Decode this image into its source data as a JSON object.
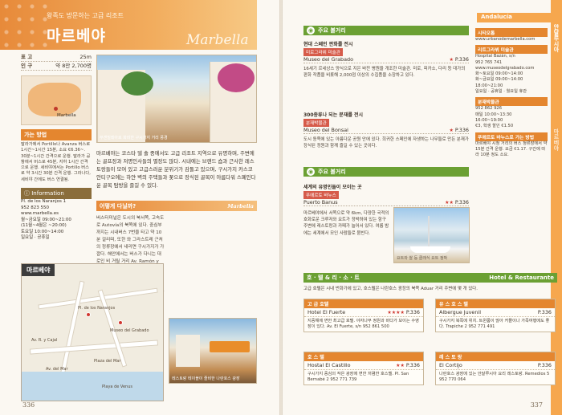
{
  "left": {
    "header": {
      "subtitle": "왕족도 방문하는 고급 리조트",
      "title": "마르베야",
      "title_en": "Marbella"
    },
    "stats": [
      {
        "k": "표 고",
        "v": "25m"
      },
      {
        "k": "인 구",
        "v": "약 8만 2,700명"
      }
    ],
    "map_label": "Marbella",
    "access": {
      "label": "가는 방법",
      "text": "말라가에서 Portillo나 Avanza 버스로 1시간~1시간 15분, 소요 €6.36~. 30분~1시간 간격으로 운행. 말라가 공항에서 버스로 45분, 지하 1시간 간격으로 운행. 세비야에서는 Portillo 버스로 약 3시간 30분 간격 운행. 그라나다, 세비야 간에도 버스 연결됨."
    },
    "info": {
      "label": "Information",
      "lines": [
        "Pl. de los Naranjos 1",
        "952 823 550",
        "www.marbella.es",
        "월~금요일 09:00~21:00",
        "(11월~4월은 ~20:00)",
        "토요일 10:00~14:00",
        "일요일 · 공휴일"
      ]
    },
    "photo_caption": "부겐빌레아로 화려한 구시가지 거리 풍경",
    "intro": "마르베야는 코스타 델 솔 중에서도 고급 리조트 지역으로 유명하며, 주변에는 골프장과 저명인사들의 별장도 많다. 시내에는 브랜드 숍과 근사한 레스토랑들이 모여 있고 고급스러운 분위기가 감돌고 있으며, 구시가지 카스코 안티구오에는 하얀 벽의 주택들과 꽃으로 장식된 골목이 아름다워 스페인다운 골목 탐방을 즐길 수 있다.",
    "section": {
      "title": "어떻게 다닐까?",
      "title_en": "Marbella"
    },
    "body": "버스터미널은 도시의 북서쪽, 고속도로 Autovía의 북쪽에 있다. 중심부까지는 시내버스 7번을 타고 약 10분 걸리며, 또한 와 그라스트레 근처의 정류장에서 내리면 구시가지가 가깝다. 해안에서는 버스가 다니는 대로인 비 거릴 거리 Av. Ramón y Cajal과 정세로 된 바다쪽의 산책로로 이어지는 해변 산책로가 있어 자연스러운 분위기 속에서 산책하기에 좋다. 골목 안 숨은 곳에 작은 레스토랑과 카페가 모여 있어 쉬어가기도 좋다. 오렌지 나무가 늘어서 있는 나란호스 광장 Pl. de los Naranjos이 구시가지의 중심으로, 광장에 면한 시청사의 한 모퉁이에 안내소가 있다.",
    "map_title": "마르베야",
    "map_labels": [
      "Pl. de los Naranjos",
      "Museo del Grabado",
      "Plaza del Mar",
      "Av. R. y Cajal",
      "Playa de Venus",
      "Av. del Mar"
    ],
    "photo2_caption": "레스토랑 테이블이 즐비한 나란호스 광장",
    "page_no": "336"
  },
  "right": {
    "region": "Andalucía",
    "tab_ko": "안달루시아",
    "tab_city": "마르베야",
    "sight_bar": "주요 볼거리",
    "sights": [
      {
        "sub": "현대 스페인 판화를 전시",
        "tag": "미로그라뷔 미술관",
        "name": "Museo del Grabado",
        "page": "P.336",
        "text": "16세기 르네상스 양식으로 지은 바잔 병원을 개조한 미술관. 미로, 피카소, 다리 등 대가의 판화 작품을 비롯해 2,000점 이상의 수집품을 소장하고 있다."
      },
      {
        "sub": "300종류나 되는 분재를 전시",
        "tag": "분재박물관",
        "name": "Museo del Bonsai",
        "page": "P.336",
        "text": "도시 동쪽에 있는 아름다운 공원 안에 있다. 희귀한 스페인에 자생하는 나무들로 만든 분재가 장식된 정원과 함께 즐길 수 있는 곳이다."
      }
    ],
    "sight_bar2": "주요 볼거리",
    "port": {
      "sub": "세계의 유명인들이 모이는 곳",
      "tag": "푸에르토 바누스",
      "name": "Puerto Banus",
      "page": "P.336",
      "text": "마르베야에서 서쪽으로 약 6km, 다양한 국적의 호화로운 크루저와 요트가 정박하여 있는 항구 주변에 레스토랑과 카페가 늘어서 있다. 여름 밤에는 세계에서 모인 사람들로 붐빈다.",
      "caption": "요트와 쌀 등 클래식 요트 정박"
    },
    "side": [
      {
        "head": "시티오톱",
        "lines": [
          "www.urbanodemarbella.com"
        ]
      },
      {
        "head": "리트그라뷔 미술관",
        "lines": [
          "Hospital Bazán, s/n",
          "952 765 741",
          "www.museodelgrabado.com",
          "화~토요일 09:00~14:00",
          "화~금요일 09:00~14:00",
          "18:00~21:00",
          "일요일 · 공휴일 · 월요일 휴관"
        ]
      },
      {
        "head": "분재박물관",
        "lines": [
          "952 862 926",
          "매일 10:00~13:30",
          "16:00~19:00",
          "€3, 학생 할인 €1.50"
        ]
      },
      {
        "head": "푸에르토 바누스로 가는 방법",
        "lines": [
          "마르베야 시청 거리의 버스 정류장에서 약 15분 간격 운행. 요금 €1.17. 구간에 따라 10분 정도 소요."
        ]
      }
    ],
    "hotel_bar": {
      "title": "호 · 텔 & 리 · 소 · 트",
      "title_en": "Hotel & Restaurante"
    },
    "hotel_intro": "고급 호텔은 시내 번화가에 있고, 호스텔은 나란호스 광장의 북쪽 Aduar 거리 주변에 몇 개 있다.",
    "hotels": [
      {
        "head": "고 급 호텔",
        "name": "Hotel El Fuerte",
        "stars": "★★★★",
        "page": "P.336",
        "text": "지중해에 면한 최고급 호텔. 야자나무 정원과 바다가 보이는 수영장이 있다. Av. El Fuerte, s/n 952 861 500"
      },
      {
        "head": "유 스 호 스 텔",
        "name": "Albergue Juvenil",
        "stars": "",
        "page": "P.336",
        "text": "구시가지 북쪽에 위치. 트윈룸이 많아 커플이나 가족여행에도 좋다. Trapiche 2 952 771 491"
      },
      {
        "head": "호 스 텔",
        "name": "Hostal El Castillo",
        "stars": "★★",
        "page": "P.336",
        "text": "구시가지 중심의 작은 광장에 면한 저렴한 호스텔. Pl. San Bernabé 2 952 771 739"
      },
      {
        "head": "레 스 토 랑",
        "name": "El Cortijo",
        "stars": "",
        "page": "P.336",
        "text": "나란호스 광장에 있는 안달루시아 요리 레스토랑. Remedios 5 952 770 064"
      }
    ],
    "page_no": "337"
  }
}
